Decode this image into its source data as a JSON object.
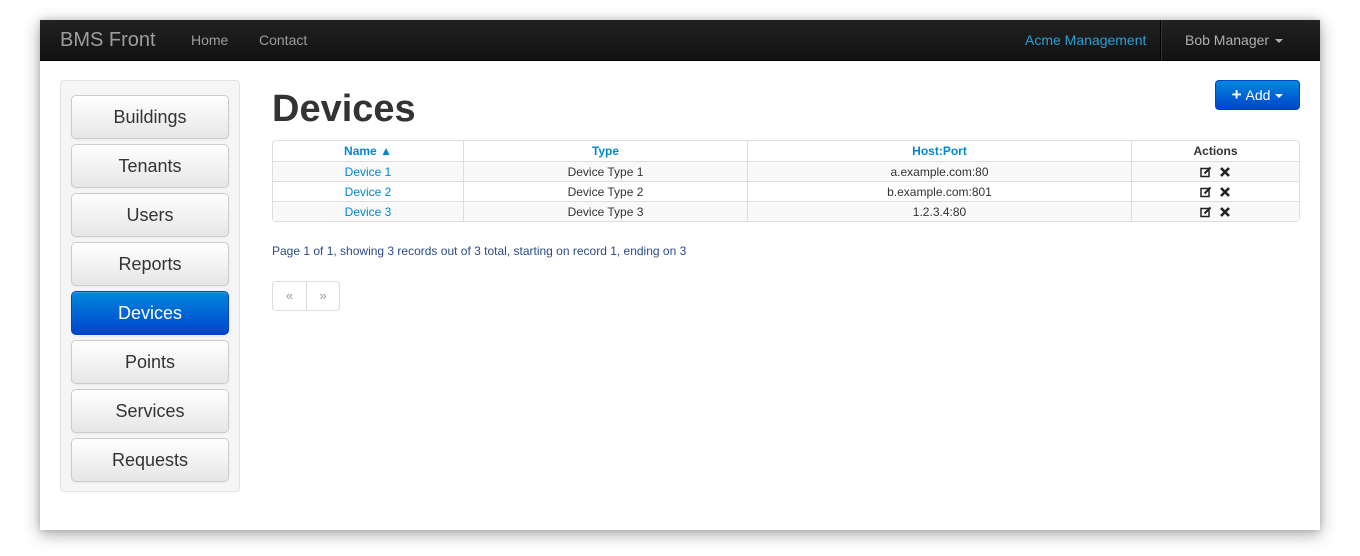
{
  "navbar": {
    "brand": "BMS Front",
    "links": [
      "Home",
      "Contact"
    ],
    "org": "Acme Management",
    "user": "Bob Manager"
  },
  "sidebar": {
    "items": [
      {
        "label": "Buildings",
        "active": false
      },
      {
        "label": "Tenants",
        "active": false
      },
      {
        "label": "Users",
        "active": false
      },
      {
        "label": "Reports",
        "active": false
      },
      {
        "label": "Devices",
        "active": true
      },
      {
        "label": "Points",
        "active": false
      },
      {
        "label": "Services",
        "active": false
      },
      {
        "label": "Requests",
        "active": false
      }
    ]
  },
  "main": {
    "title": "Devices",
    "add_label": "Add",
    "table": {
      "headers": [
        "Name ▲",
        "Type",
        "Host:Port",
        "Actions"
      ],
      "rows": [
        {
          "name": "Device 1",
          "type": "Device Type 1",
          "host": "a.example.com:80"
        },
        {
          "name": "Device 2",
          "type": "Device Type 2",
          "host": "b.example.com:801"
        },
        {
          "name": "Device 3",
          "type": "Device Type 3",
          "host": "1.2.3.4:80"
        }
      ]
    },
    "summary": "Page 1 of 1, showing 3 records out of 3 total, starting on record 1, ending on 3",
    "pager": {
      "prev": "«",
      "next": "»"
    }
  },
  "icons": {
    "edit": "edit-icon",
    "delete": "delete-icon",
    "plus": "plus-icon"
  }
}
